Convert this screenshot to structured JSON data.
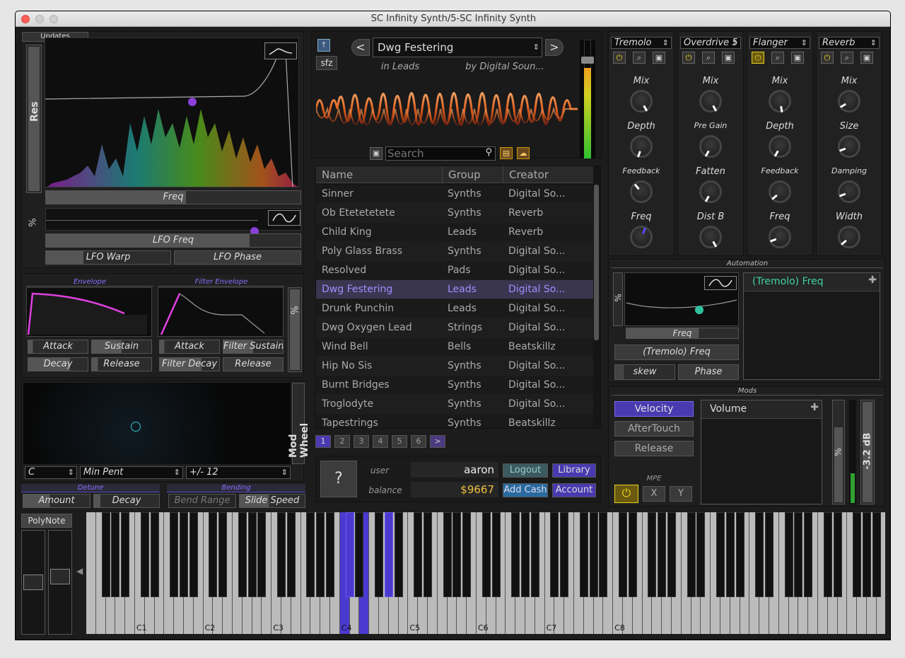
{
  "window": {
    "title": "SC Infinity Synth/5-SC Infinity Synth"
  },
  "filter": {
    "updates_label": "Updates",
    "res_label": "Res",
    "freq_label": "Freq",
    "lfo_percent": "%",
    "lfo_freq_label": "LFO Freq",
    "lfo_warp_label": "LFO Warp",
    "lfo_phase_label": "LFO Phase"
  },
  "envelope": {
    "header": "Envelope",
    "attack": "Attack",
    "sustain": "Sustain",
    "decay": "Decay",
    "release": "Release"
  },
  "filter_envelope": {
    "header": "Filter Envelope",
    "attack": "Attack",
    "sustain": "Filter Sustain",
    "decay": "Filter Decay",
    "release": "Release",
    "percent": "%"
  },
  "pad": {
    "mod_wheel": "Mod Wheel",
    "key": "C",
    "scale": "Min Pent",
    "range": "+/- 12"
  },
  "detune": {
    "header": "Detune",
    "amount": "Amount",
    "decay": "Decay"
  },
  "bending": {
    "header": "Bending",
    "range": "Bend Range",
    "speed": "Slide Speed"
  },
  "browser": {
    "sfz": "sfz",
    "preset_name": "Dwg Festering",
    "category": "in Leads",
    "author": "by Digital Soun...",
    "search_placeholder": "Search",
    "prev": "<",
    "next": ">"
  },
  "table": {
    "headers": [
      "Name",
      "Group",
      "Creator"
    ],
    "rows": [
      [
        "Sinner",
        "Synths",
        "Digital So..."
      ],
      [
        "Ob Etetetetete",
        "Synths",
        "Reverb"
      ],
      [
        "Child King",
        "Leads",
        "Reverb"
      ],
      [
        "Poly Glass Brass",
        "Synths",
        "Digital So..."
      ],
      [
        "Resolved",
        "Pads",
        "Digital So..."
      ],
      [
        "Dwg Festering",
        "Leads",
        "Digital So..."
      ],
      [
        "Drunk Punchin",
        "Leads",
        "Digital So..."
      ],
      [
        "Dwg Oxygen Lead",
        "Strings",
        "Digital So..."
      ],
      [
        "Wind Bell",
        "Bells",
        "Beatskillz"
      ],
      [
        "Hip No Sis",
        "Synths",
        "Digital So..."
      ],
      [
        "Burnt Bridges",
        "Synths",
        "Digital So..."
      ],
      [
        "Troglodyte",
        "Synths",
        "Digital So..."
      ],
      [
        "Tapestrings",
        "Synths",
        "Beatskillz"
      ]
    ],
    "selected_index": 5,
    "pages": [
      "1",
      "2",
      "3",
      "4",
      "5",
      "6",
      ">"
    ]
  },
  "account": {
    "help": "?",
    "user_label": "user",
    "user_value": "aaron",
    "balance_label": "balance",
    "balance_value": "$9667",
    "logout": "Logout",
    "library": "Library",
    "add_cash": "Add Cash",
    "account": "Account"
  },
  "effects": [
    {
      "name": "Tremolo",
      "knobs": [
        "Mix",
        "Depth",
        "Feedback",
        "Freq"
      ],
      "power_on": false
    },
    {
      "name": "Overdrive 5",
      "knobs": [
        "Mix",
        "Pre Gain",
        "Fatten",
        "Dist B"
      ],
      "power_on": false
    },
    {
      "name": "Flanger",
      "knobs": [
        "Mix",
        "Depth",
        "Feedback",
        "Freq"
      ],
      "power_on": true
    },
    {
      "name": "Reverb",
      "knobs": [
        "Mix",
        "Size",
        "Damping",
        "Width"
      ],
      "power_on": false
    }
  ],
  "automation": {
    "header": "Automation",
    "percent": "%",
    "freq_label": "Freq",
    "source": "(Tremolo) Freq",
    "skew": "skew",
    "phase": "Phase",
    "target": "(Tremolo) Freq"
  },
  "mods": {
    "header": "Mods",
    "velocity": "Velocity",
    "aftertouch": "AfterTouch",
    "release": "Release",
    "mpe": "MPE",
    "x": "X",
    "y": "Y",
    "target": "Volume",
    "percent": "%",
    "volume_db": "-3.2 dB"
  },
  "keyboard": {
    "polynote": "PolyNote",
    "octave_labels": [
      "C1",
      "C2",
      "C3",
      "C4",
      "C5",
      "C6",
      "C7",
      "C8"
    ]
  },
  "colors": {
    "accent": "#7b6bff",
    "selected_row": "#3a3650",
    "green": "#3fd29a",
    "power": "#e6d21f"
  }
}
